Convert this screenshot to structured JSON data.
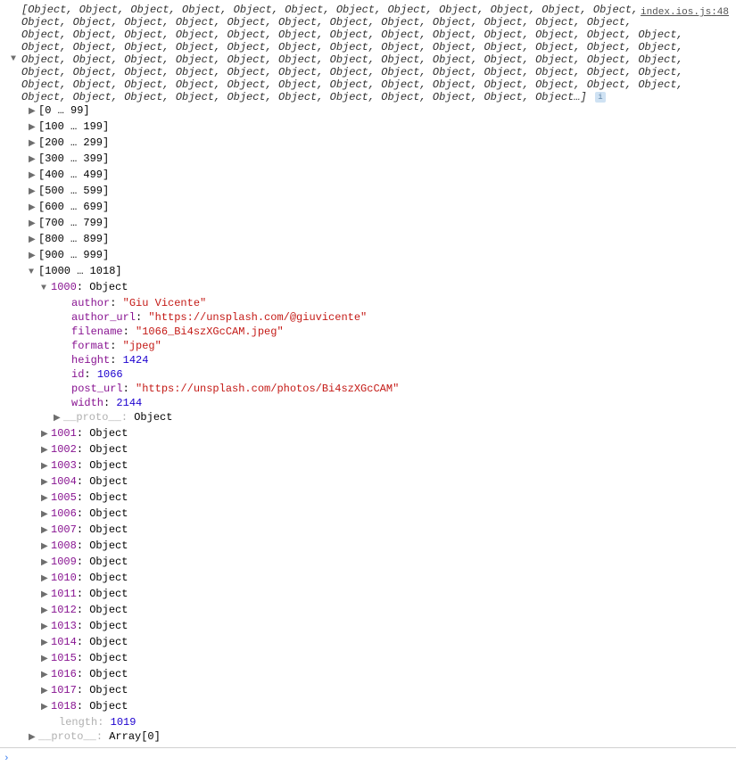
{
  "source": {
    "file": "index.ios.js",
    "line": "48"
  },
  "arraySummary": "[Object, Object, Object, Object, Object, Object, Object, Object, Object, Object, Object, Object, Object, Object, Object, Object, Object, Object, Object, Object, Object, Object, Object, Object, Object, Object, Object, Object, Object, Object, Object, Object, Object, Object, Object, Object, Object, Object, Object, Object, Object, Object, Object, Object, Object, Object, Object, Object, Object, Object, Object, Object, Object, Object, Object, Object, Object, Object, Object, Object, Object, Object, Object, Object, Object, Object, Object, Object, Object, Object, Object, Object, Object, Object, Object, Object, Object, Object, Object, Object, Object, Object, Object, Object, Object, Object, Object, Object, Object, Object, Object, Object, Object, Object, Object, Object, Object, Object, Object, Object…]",
  "infoBadge": "i",
  "ranges": [
    {
      "label": "[0 … 99]",
      "expanded": false
    },
    {
      "label": "[100 … 199]",
      "expanded": false
    },
    {
      "label": "[200 … 299]",
      "expanded": false
    },
    {
      "label": "[300 … 399]",
      "expanded": false
    },
    {
      "label": "[400 … 499]",
      "expanded": false
    },
    {
      "label": "[500 … 599]",
      "expanded": false
    },
    {
      "label": "[600 … 699]",
      "expanded": false
    },
    {
      "label": "[700 … 799]",
      "expanded": false
    },
    {
      "label": "[800 … 899]",
      "expanded": false
    },
    {
      "label": "[900 … 999]",
      "expanded": false
    },
    {
      "label": "[1000 … 1018]",
      "expanded": true
    }
  ],
  "expandedIndex": {
    "key": "1000",
    "typeLabel": "Object",
    "expanded": true
  },
  "objectProps": [
    {
      "key": "author",
      "value": "\"Giu Vicente\"",
      "type": "str"
    },
    {
      "key": "author_url",
      "value": "\"https://unsplash.com/@giuvicente\"",
      "type": "str"
    },
    {
      "key": "filename",
      "value": "\"1066_Bi4szXGcCAM.jpeg\"",
      "type": "str"
    },
    {
      "key": "format",
      "value": "\"jpeg\"",
      "type": "str"
    },
    {
      "key": "height",
      "value": "1424",
      "type": "num"
    },
    {
      "key": "id",
      "value": "1066",
      "type": "num"
    },
    {
      "key": "post_url",
      "value": "\"https://unsplash.com/photos/Bi4szXGcCAM\"",
      "type": "str"
    },
    {
      "key": "width",
      "value": "2144",
      "type": "num"
    }
  ],
  "objectProto": {
    "label": "__proto__",
    "value": "Object"
  },
  "siblingItems": [
    {
      "key": "1001",
      "value": "Object"
    },
    {
      "key": "1002",
      "value": "Object"
    },
    {
      "key": "1003",
      "value": "Object"
    },
    {
      "key": "1004",
      "value": "Object"
    },
    {
      "key": "1005",
      "value": "Object"
    },
    {
      "key": "1006",
      "value": "Object"
    },
    {
      "key": "1007",
      "value": "Object"
    },
    {
      "key": "1008",
      "value": "Object"
    },
    {
      "key": "1009",
      "value": "Object"
    },
    {
      "key": "1010",
      "value": "Object"
    },
    {
      "key": "1011",
      "value": "Object"
    },
    {
      "key": "1012",
      "value": "Object"
    },
    {
      "key": "1013",
      "value": "Object"
    },
    {
      "key": "1014",
      "value": "Object"
    },
    {
      "key": "1015",
      "value": "Object"
    },
    {
      "key": "1016",
      "value": "Object"
    },
    {
      "key": "1017",
      "value": "Object"
    },
    {
      "key": "1018",
      "value": "Object"
    }
  ],
  "lengthProp": {
    "key": "length",
    "value": "1019"
  },
  "arrayProto": {
    "label": "__proto__",
    "value": "Array[0]"
  },
  "colon": ": "
}
